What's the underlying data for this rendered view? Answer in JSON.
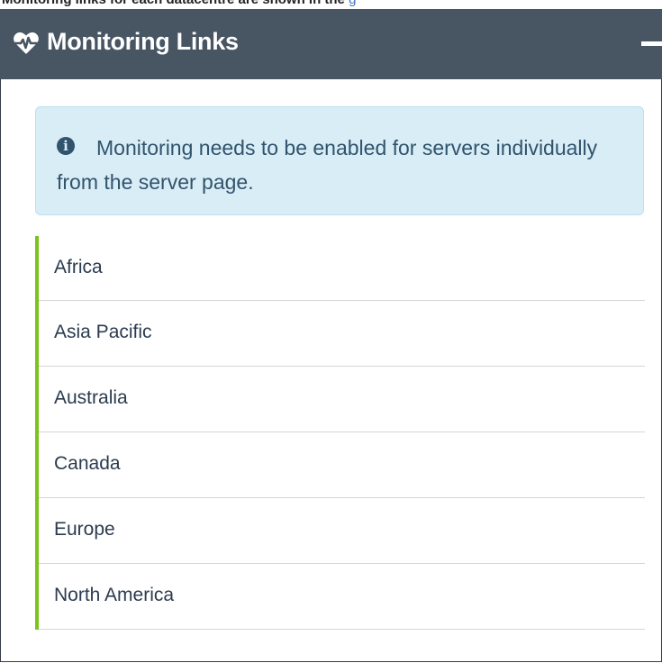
{
  "top_strip": {
    "text": "Monitoring links for each datacentre are shown in the",
    "link_text": "g"
  },
  "panel": {
    "title": "Monitoring Links",
    "title_icon": "heartbeat-icon",
    "collapse_icon": "minus-icon"
  },
  "info": {
    "icon": "info-circle-icon",
    "message": "Monitoring needs to be enabled for servers individually from the server page."
  },
  "links": [
    {
      "label": "Africa"
    },
    {
      "label": "Asia Pacific"
    },
    {
      "label": "Australia"
    },
    {
      "label": "Canada"
    },
    {
      "label": "Europe"
    },
    {
      "label": "North America"
    }
  ],
  "colors": {
    "header_bg": "#485563",
    "info_bg": "#d9edf7",
    "info_text": "#31536c",
    "accent_green": "#7dc21e",
    "link_text": "#2b3b4f"
  }
}
